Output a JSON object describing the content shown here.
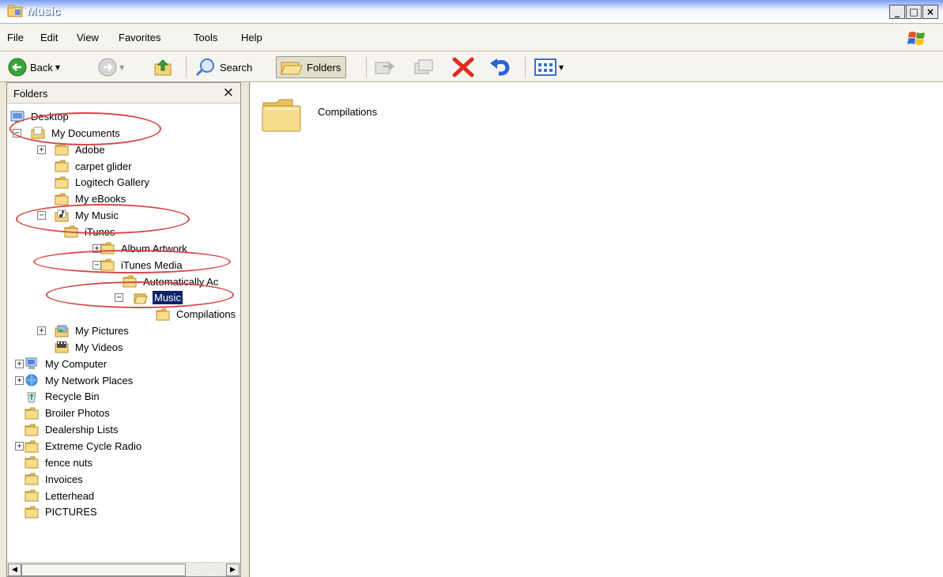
{
  "window": {
    "title": "Music",
    "minimize": "_",
    "maximize": "□",
    "close": "×"
  },
  "menu": [
    "File",
    "Edit",
    "View",
    "Favorites",
    "Tools",
    "Help"
  ],
  "toolbar": {
    "back_label": "Back",
    "search_label": "Search",
    "folders_label": "Folders"
  },
  "left_pane": {
    "title": "Folders",
    "close": "×"
  },
  "tree": [
    {
      "label": "Desktop",
      "icon": "desktop-icon",
      "expander": ""
    },
    {
      "label": "My Documents",
      "icon": "my-documents-icon",
      "expander": "minus"
    },
    {
      "label": "Adobe",
      "icon": "folder-icon",
      "expander": "plus"
    },
    {
      "label": "carpet glider",
      "icon": "folder-icon",
      "expander": ""
    },
    {
      "label": "Logitech Gallery",
      "icon": "folder-icon",
      "expander": ""
    },
    {
      "label": "My eBooks",
      "icon": "folder-icon",
      "expander": ""
    },
    {
      "label": "My Music",
      "icon": "my-music-icon",
      "expander": "minus"
    },
    {
      "label": "iTunes",
      "icon": "folder-icon",
      "expander": "minus"
    },
    {
      "label": "Album Artwork",
      "icon": "folder-icon",
      "expander": "plus"
    },
    {
      "label": "iTunes Media",
      "icon": "folder-icon",
      "expander": "minus"
    },
    {
      "label": "Automatically Ac",
      "icon": "folder-icon",
      "expander": ""
    },
    {
      "label": "Music",
      "icon": "folder-open-icon",
      "expander": "minus",
      "selected": true
    },
    {
      "label": "Compilations",
      "icon": "folder-icon",
      "expander": ""
    },
    {
      "label": "My Pictures",
      "icon": "my-pictures-icon",
      "expander": "plus"
    },
    {
      "label": "My Videos",
      "icon": "my-videos-icon",
      "expander": ""
    },
    {
      "label": "My Computer",
      "icon": "my-computer-icon",
      "expander": "plus"
    },
    {
      "label": "My Network Places",
      "icon": "network-icon",
      "expander": "plus"
    },
    {
      "label": "Recycle Bin",
      "icon": "recycle-bin-icon",
      "expander": ""
    },
    {
      "label": "Broiler Photos",
      "icon": "folder-icon",
      "expander": ""
    },
    {
      "label": "Dealership Lists",
      "icon": "folder-icon",
      "expander": ""
    },
    {
      "label": "Extreme Cycle Radio",
      "icon": "folder-icon",
      "expander": "plus"
    },
    {
      "label": "fence nuts",
      "icon": "folder-icon",
      "expander": ""
    },
    {
      "label": "Invoices",
      "icon": "folder-icon",
      "expander": ""
    },
    {
      "label": "Letterhead",
      "icon": "folder-icon",
      "expander": ""
    },
    {
      "label": "PICTURES",
      "icon": "folder-icon",
      "expander": ""
    }
  ],
  "content": {
    "items": [
      "Compilations"
    ]
  },
  "colors": {
    "selection": "#0a246a",
    "annotation": "#d94848",
    "folder": "#f3d37a"
  }
}
